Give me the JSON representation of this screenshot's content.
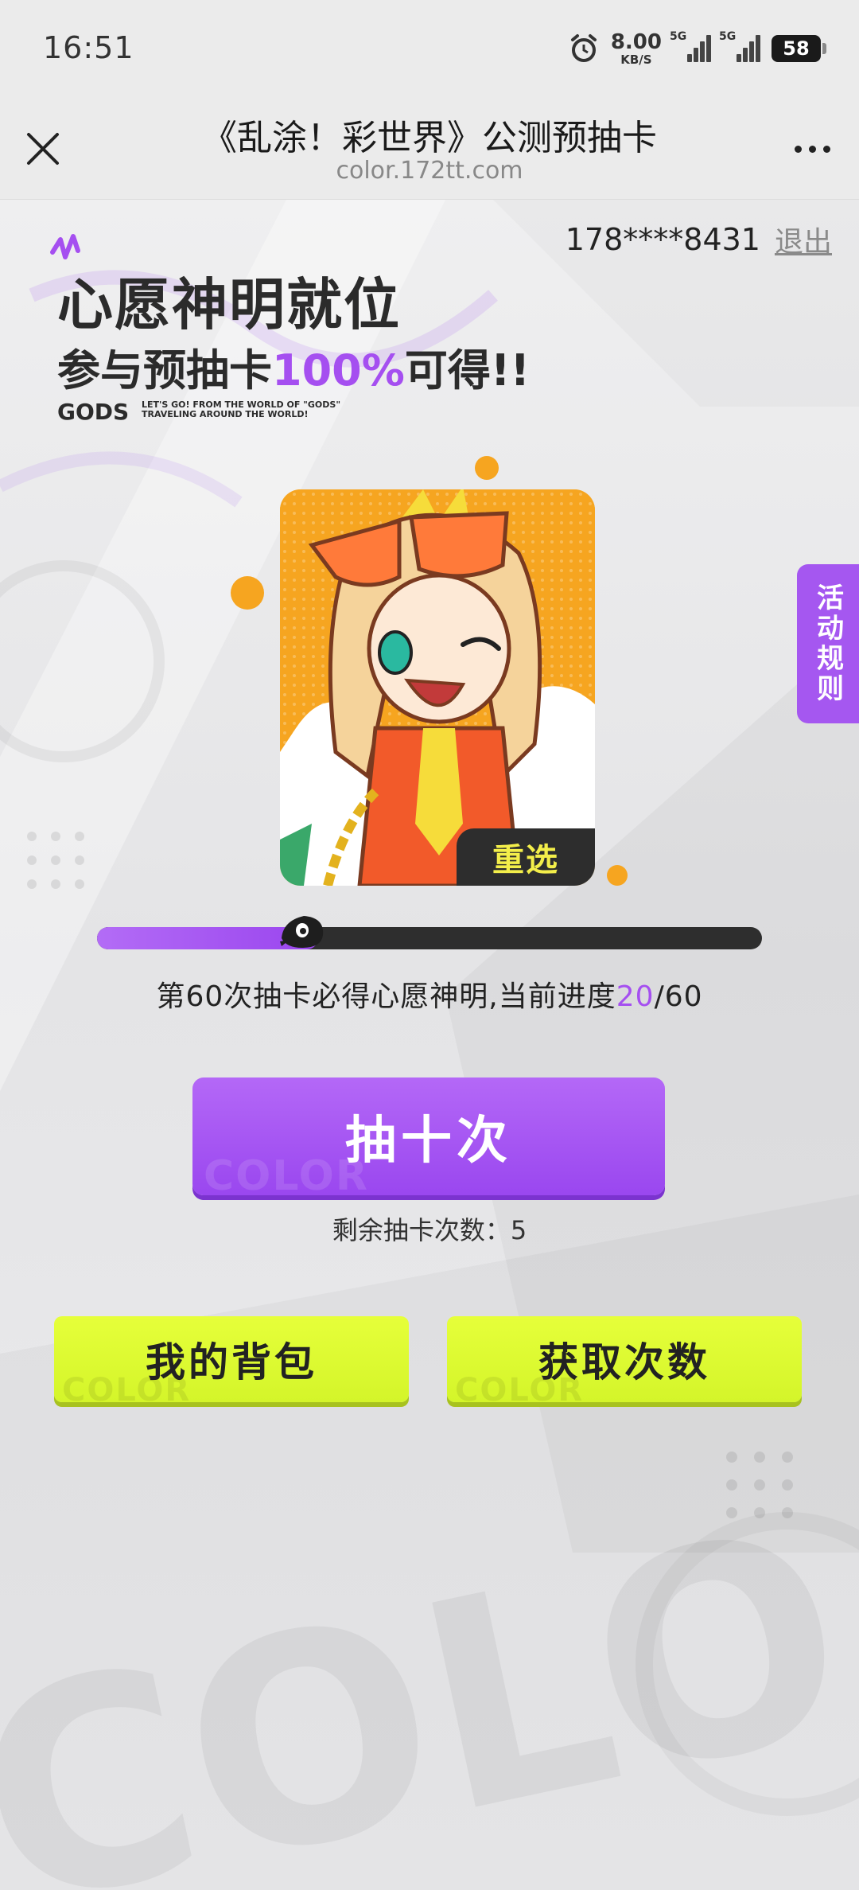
{
  "status_bar": {
    "time": "16:51",
    "net_speed_value": "8.00",
    "net_speed_unit": "KB/S",
    "signal_1_tag": "5G",
    "signal_2_tag": "5G",
    "battery_level": "58"
  },
  "title_bar": {
    "title": "《乱涂！彩世界》公测预抽卡",
    "url": "color.172tt.com"
  },
  "user": {
    "phone": "178****8431",
    "logout_label": "退出"
  },
  "banner": {
    "headline_1": "心愿神明就位",
    "headline_2_prefix": "参与预抽卡",
    "headline_2_highlight": "100%",
    "headline_2_suffix": "可得!!",
    "gods_word": "GODS",
    "gods_sub": "LET'S GO! FROM THE WORLD OF \"GODS\" TRAVELING AROUND THE WORLD!"
  },
  "card": {
    "reselect_label": "重选"
  },
  "side_tab": {
    "label": "活动规则"
  },
  "progress": {
    "prefix": "第60次抽卡必得心愿神明,当前进度",
    "current": "20",
    "separator": "/",
    "total": "60",
    "fraction": 0.333
  },
  "draw_button": {
    "label": "抽十次",
    "watermark": "COLOR"
  },
  "remaining": {
    "text": "剩余抽卡次数：5"
  },
  "bottom_buttons": {
    "bag_label": "我的背包",
    "get_label": "获取次数",
    "watermark": "COLOR"
  },
  "colors": {
    "purple": "#a54ff0",
    "lime": "#e6ff3a",
    "card_orange": "#f6a520"
  }
}
